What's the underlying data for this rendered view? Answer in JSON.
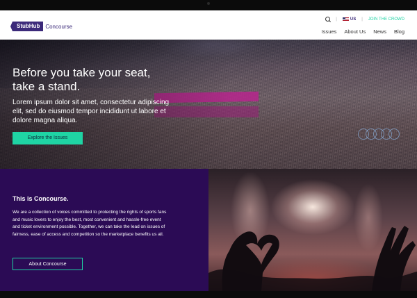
{
  "brand": {
    "logo_mark": "StubHub",
    "logo_name": "Concourse"
  },
  "utility": {
    "region": "US",
    "join_label": "JOIN THE CROWD"
  },
  "nav": [
    "Issues",
    "About Us",
    "News",
    "Blog"
  ],
  "hero": {
    "title_line1": "Before you take your seat,",
    "title_line2": "take a stand.",
    "body": "Lorem ipsum dolor sit amet, consectetur adipiscing elit, sed do eiusmod tempor incididunt ut labore et dolore magna aliqua.",
    "cta": "Explore the Issues"
  },
  "about": {
    "title_prefix": "This is ",
    "title_bold": "Concourse.",
    "body": "We are a collection of voices committed to protecting the rights of sports fans and music lovers to enjoy the best, most convenient and hassle-free event and ticket environment possible. Together, we can take the lead on issues of fairness, ease of access and competition so the marketplace benefits us all.",
    "cta": "About Concourse"
  },
  "colors": {
    "brand_purple": "#3c2a7a",
    "accent_green": "#1fd4a4",
    "about_bg": "#2b0b55"
  },
  "icons": [
    "search-icon",
    "us-flag-icon"
  ]
}
